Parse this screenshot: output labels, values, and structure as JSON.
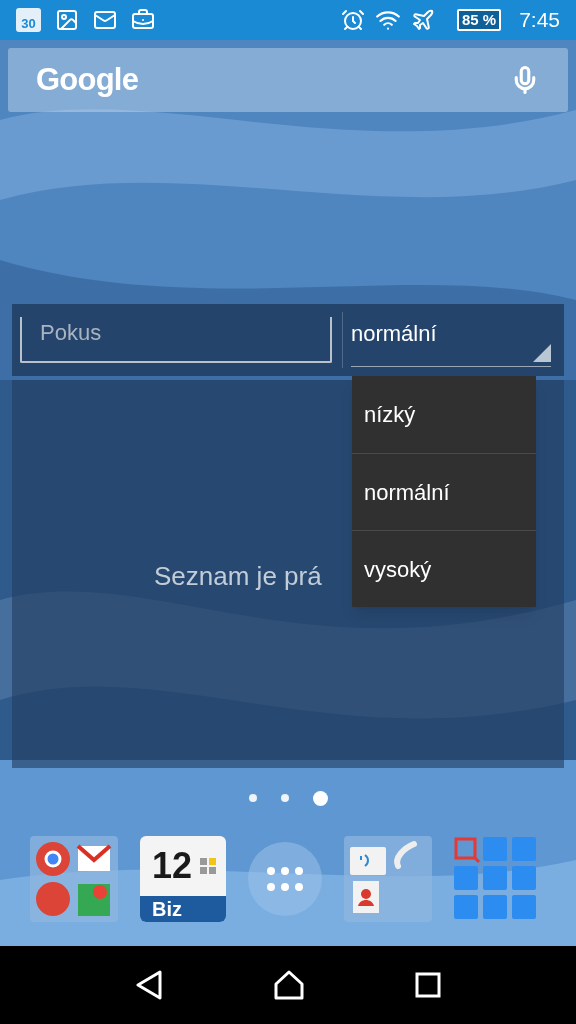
{
  "status_bar": {
    "calendar_day": "30",
    "battery": "85 %",
    "time": "7:45"
  },
  "search_bar": {
    "logo_text": "Google"
  },
  "widget": {
    "field": {
      "placeholder": "Pokus"
    },
    "spinner": {
      "value": "normální",
      "expanded": true,
      "options": [
        "nízký",
        "normální",
        "vysoký"
      ]
    },
    "empty_text": "Seznam je prá"
  },
  "page_indicator": [
    {
      "selected": false
    },
    {
      "selected": false
    },
    {
      "selected": true
    }
  ],
  "dock": {
    "calendar_app": {
      "day": "12",
      "label": "Biz"
    }
  }
}
